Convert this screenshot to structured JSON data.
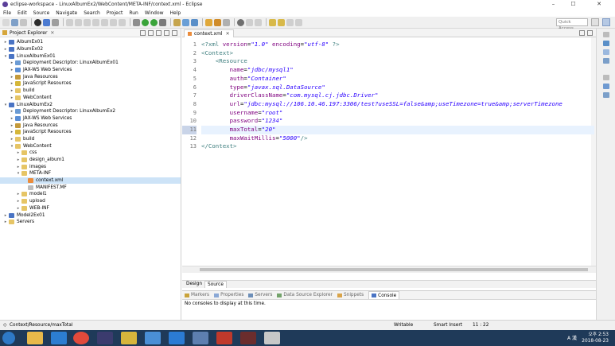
{
  "window": {
    "title": "eclipse-workspace - LinuxAlbumEx2/WebContent/META-INF/context.xml - Eclipse"
  },
  "menu": [
    "File",
    "Edit",
    "Source",
    "Navigate",
    "Search",
    "Project",
    "Run",
    "Window",
    "Help"
  ],
  "toolbar": {
    "quick_access_placeholder": "Quick Access"
  },
  "explorer": {
    "title": "Project Explorer",
    "tree": [
      {
        "label": "AlbumEx01",
        "depth": 0,
        "icon": "project",
        "twisty": "▸"
      },
      {
        "label": "AlbumEx02",
        "depth": 0,
        "icon": "project",
        "twisty": "▸"
      },
      {
        "label": "LinuxAlbumEx01",
        "depth": 0,
        "icon": "project",
        "twisty": "▾"
      },
      {
        "label": "Deployment Descriptor: LinuxAlbumEx01",
        "depth": 1,
        "icon": "desc",
        "twisty": "▸"
      },
      {
        "label": "JAX-WS Web Services",
        "depth": 1,
        "icon": "web",
        "twisty": "▸"
      },
      {
        "label": "Java Resources",
        "depth": 1,
        "icon": "pkg",
        "twisty": "▸"
      },
      {
        "label": "JavaScript Resources",
        "depth": 1,
        "icon": "js",
        "twisty": "▸"
      },
      {
        "label": "build",
        "depth": 1,
        "icon": "folder",
        "twisty": "▸"
      },
      {
        "label": "WebContent",
        "depth": 1,
        "icon": "folder",
        "twisty": "▸"
      },
      {
        "label": "LinuxAlbumEx2",
        "depth": 0,
        "icon": "project",
        "twisty": "▾"
      },
      {
        "label": "Deployment Descriptor: LinuxAlbumEx2",
        "depth": 1,
        "icon": "desc",
        "twisty": "▸"
      },
      {
        "label": "JAX-WS Web Services",
        "depth": 1,
        "icon": "web",
        "twisty": "▸"
      },
      {
        "label": "Java Resources",
        "depth": 1,
        "icon": "pkg",
        "twisty": "▸"
      },
      {
        "label": "JavaScript Resources",
        "depth": 1,
        "icon": "js",
        "twisty": "▸"
      },
      {
        "label": "build",
        "depth": 1,
        "icon": "folder",
        "twisty": "▸"
      },
      {
        "label": "WebContent",
        "depth": 1,
        "icon": "folder",
        "twisty": "▾"
      },
      {
        "label": "css",
        "depth": 2,
        "icon": "folder",
        "twisty": "▸"
      },
      {
        "label": "design_album1",
        "depth": 2,
        "icon": "folder",
        "twisty": "▸"
      },
      {
        "label": "images",
        "depth": 2,
        "icon": "folder",
        "twisty": "▸"
      },
      {
        "label": "META-INF",
        "depth": 2,
        "icon": "folder",
        "twisty": "▾"
      },
      {
        "label": "context.xml",
        "depth": 3,
        "icon": "xml",
        "twisty": "",
        "selected": true
      },
      {
        "label": "MANIFEST.MF",
        "depth": 3,
        "icon": "mf",
        "twisty": ""
      },
      {
        "label": "model1",
        "depth": 2,
        "icon": "folder",
        "twisty": "▸"
      },
      {
        "label": "upload",
        "depth": 2,
        "icon": "folder",
        "twisty": "▸"
      },
      {
        "label": "WEB-INF",
        "depth": 2,
        "icon": "folder",
        "twisty": "▸"
      },
      {
        "label": "Model2Ex01",
        "depth": 0,
        "icon": "project",
        "twisty": "▸"
      },
      {
        "label": "Servers",
        "depth": 0,
        "icon": "folder",
        "twisty": "▸"
      }
    ]
  },
  "editor": {
    "tab": "context.xml",
    "current_line": 11,
    "lines": [
      {
        "n": "1",
        "indent": "",
        "tokens": [
          [
            "tag",
            "<?xml "
          ],
          [
            "attr",
            "version"
          ],
          [
            "plain",
            "="
          ],
          [
            "str",
            "\"1.0\""
          ],
          [
            "plain",
            " "
          ],
          [
            "attr",
            "encoding"
          ],
          [
            "plain",
            "="
          ],
          [
            "str",
            "\"utf-8\""
          ],
          [
            "tag",
            " ?>"
          ]
        ]
      },
      {
        "n": "2",
        "indent": "",
        "tokens": [
          [
            "tag",
            "<Context>"
          ]
        ]
      },
      {
        "n": "3",
        "indent": "    ",
        "tokens": [
          [
            "tag",
            "<Resource"
          ]
        ]
      },
      {
        "n": "4",
        "indent": "        ",
        "tokens": [
          [
            "attr",
            "name"
          ],
          [
            "plain",
            "="
          ],
          [
            "str",
            "\"jdbc/mysql1\""
          ]
        ]
      },
      {
        "n": "5",
        "indent": "        ",
        "tokens": [
          [
            "attr",
            "auth"
          ],
          [
            "plain",
            "="
          ],
          [
            "str",
            "\"Container\""
          ]
        ]
      },
      {
        "n": "6",
        "indent": "        ",
        "tokens": [
          [
            "attr",
            "type"
          ],
          [
            "plain",
            "="
          ],
          [
            "str",
            "\"javax.sql.DataSource\""
          ]
        ]
      },
      {
        "n": "7",
        "indent": "        ",
        "tokens": [
          [
            "attr",
            "driverClassName"
          ],
          [
            "plain",
            "="
          ],
          [
            "str",
            "\"com.mysql.cj.jdbc.Driver\""
          ]
        ]
      },
      {
        "n": "8",
        "indent": "        ",
        "tokens": [
          [
            "attr",
            "url"
          ],
          [
            "plain",
            "="
          ],
          [
            "str",
            "\"jdbc:mysql://106.10.46.197:3306/test?useSSL=false&amp;useTimezone=true&amp;serverTimezone"
          ]
        ]
      },
      {
        "n": "9",
        "indent": "        ",
        "tokens": [
          [
            "attr",
            "username"
          ],
          [
            "plain",
            "="
          ],
          [
            "str",
            "\"root\""
          ]
        ]
      },
      {
        "n": "10",
        "indent": "        ",
        "tokens": [
          [
            "attr",
            "password"
          ],
          [
            "plain",
            "="
          ],
          [
            "str",
            "\"1234\""
          ]
        ]
      },
      {
        "n": "11",
        "indent": "        ",
        "tokens": [
          [
            "attr",
            "maxTotal"
          ],
          [
            "plain",
            "="
          ],
          [
            "str",
            "\"20\""
          ]
        ]
      },
      {
        "n": "12",
        "indent": "        ",
        "tokens": [
          [
            "attr",
            "maxWaitMillis"
          ],
          [
            "plain",
            "="
          ],
          [
            "str",
            "\"5000\""
          ],
          [
            "tag",
            "/>"
          ]
        ]
      },
      {
        "n": "13",
        "indent": "",
        "tokens": [
          [
            "tag",
            "</Context>"
          ]
        ]
      }
    ],
    "bottom_tabs": [
      "Design",
      "Source"
    ]
  },
  "console": {
    "tabs": [
      "Markers",
      "Properties",
      "Servers",
      "Data Source Explorer",
      "Snippets",
      "Console"
    ],
    "active_tab": "Console",
    "message": "No consoles to display at this time."
  },
  "status": {
    "path": "Context/Resource/maxTotal",
    "writable": "Writable",
    "insert_mode": "Smart Insert",
    "position": "11 : 22"
  },
  "taskbar": {
    "time": "오후 2:53",
    "date": "2018-08-23",
    "lang": "A 漢"
  },
  "colors": {
    "selection": "#cde3f7",
    "current_line": "#e8f2fe",
    "tag": "#3f7f7f",
    "attr": "#7f007f",
    "string": "#2a00ff"
  }
}
